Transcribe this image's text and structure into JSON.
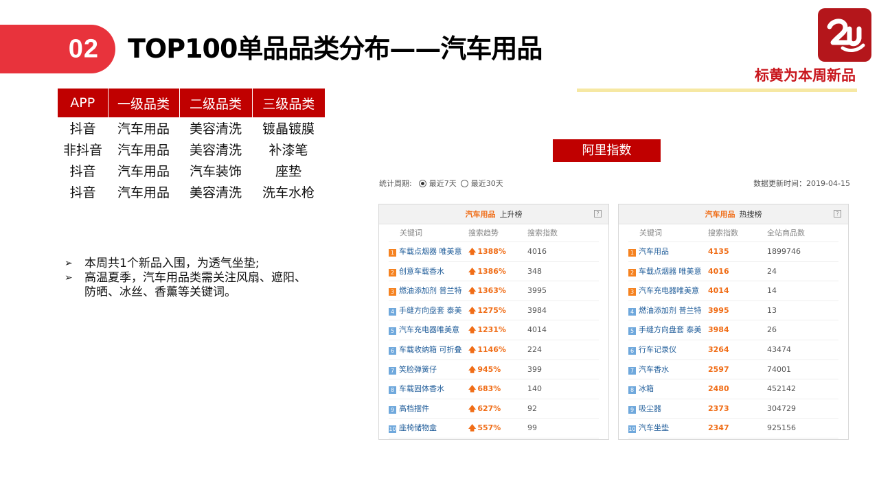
{
  "header": {
    "number": "02",
    "title": "TOP100单品品类分布——汽车用品",
    "new_tag": "标黄为本周新品"
  },
  "category_table": {
    "headers": [
      "APP",
      "一级品类",
      "二级品类",
      "三级品类"
    ],
    "rows": [
      [
        "抖音",
        "汽车用品",
        "美容清洗",
        "镀晶镀膜"
      ],
      [
        "非抖音",
        "汽车用品",
        "美容清洗",
        "补漆笔"
      ],
      [
        "抖音",
        "汽车用品",
        "汽车装饰",
        "座垫"
      ],
      [
        "抖音",
        "汽车用品",
        "美容清洗",
        "洗车水枪"
      ]
    ]
  },
  "bullets": [
    "本周共1个新品入围，为透气坐垫;",
    "高温夏季，汽车用品类需关注风扇、遮阳、防晒、冰丝、香薰等关键词。"
  ],
  "ali": {
    "button_label": "阿里指数",
    "stat_label": "统计周期:",
    "option_7": "最近7天",
    "option_30": "最近30天",
    "update_time": "数据更新时间：2019-04-15"
  },
  "rising": {
    "category": "汽车用品",
    "title": "上升榜",
    "help": "?",
    "columns": [
      "关键词",
      "搜索趋势",
      "搜索指数"
    ],
    "rows": [
      {
        "rank": "1",
        "keyword": "车载点烟器 唯美意",
        "trend": "1388%",
        "index": "4016"
      },
      {
        "rank": "2",
        "keyword": "创意车载香水",
        "trend": "1386%",
        "index": "348"
      },
      {
        "rank": "3",
        "keyword": "燃油添加剂 普兰特",
        "trend": "1363%",
        "index": "3995"
      },
      {
        "rank": "4",
        "keyword": "手缝方向盘套 泰美",
        "trend": "1275%",
        "index": "3984"
      },
      {
        "rank": "5",
        "keyword": "汽车充电器唯美意",
        "trend": "1231%",
        "index": "4014"
      },
      {
        "rank": "6",
        "keyword": "车载收纳箱 可折叠",
        "trend": "1146%",
        "index": "224"
      },
      {
        "rank": "7",
        "keyword": "笑脸弹簧仔",
        "trend": "945%",
        "index": "399"
      },
      {
        "rank": "8",
        "keyword": "车载固体香水",
        "trend": "683%",
        "index": "140"
      },
      {
        "rank": "9",
        "keyword": "高档摆件",
        "trend": "627%",
        "index": "92"
      },
      {
        "rank": "10",
        "keyword": "座椅储物盒",
        "trend": "557%",
        "index": "99"
      }
    ]
  },
  "hot": {
    "category": "汽车用品",
    "title": "热搜榜",
    "help": "?",
    "columns": [
      "关键词",
      "搜索指数",
      "全站商品数"
    ],
    "rows": [
      {
        "rank": "1",
        "keyword": "汽车用品",
        "index": "4135",
        "count": "1899746"
      },
      {
        "rank": "2",
        "keyword": "车载点烟器 唯美意",
        "index": "4016",
        "count": "24"
      },
      {
        "rank": "3",
        "keyword": "汽车充电器唯美意",
        "index": "4014",
        "count": "14"
      },
      {
        "rank": "4",
        "keyword": "燃油添加剂 普兰特",
        "index": "3995",
        "count": "13"
      },
      {
        "rank": "5",
        "keyword": "手缝方向盘套 泰美",
        "index": "3984",
        "count": "26"
      },
      {
        "rank": "6",
        "keyword": "行车记录仪",
        "index": "3264",
        "count": "43474"
      },
      {
        "rank": "7",
        "keyword": "汽车香水",
        "index": "2597",
        "count": "74001"
      },
      {
        "rank": "8",
        "keyword": "冰箱",
        "index": "2480",
        "count": "452142"
      },
      {
        "rank": "9",
        "keyword": "吸尘器",
        "index": "2373",
        "count": "304729"
      },
      {
        "rank": "10",
        "keyword": "汽车坐垫",
        "index": "2347",
        "count": "925156"
      }
    ]
  },
  "colors": {
    "accent_red": "#e8333c",
    "table_red": "#c00000",
    "trend_orange": "#f06d17",
    "rank_hot": "#f58220",
    "rank_cool": "#6fa8dc"
  }
}
